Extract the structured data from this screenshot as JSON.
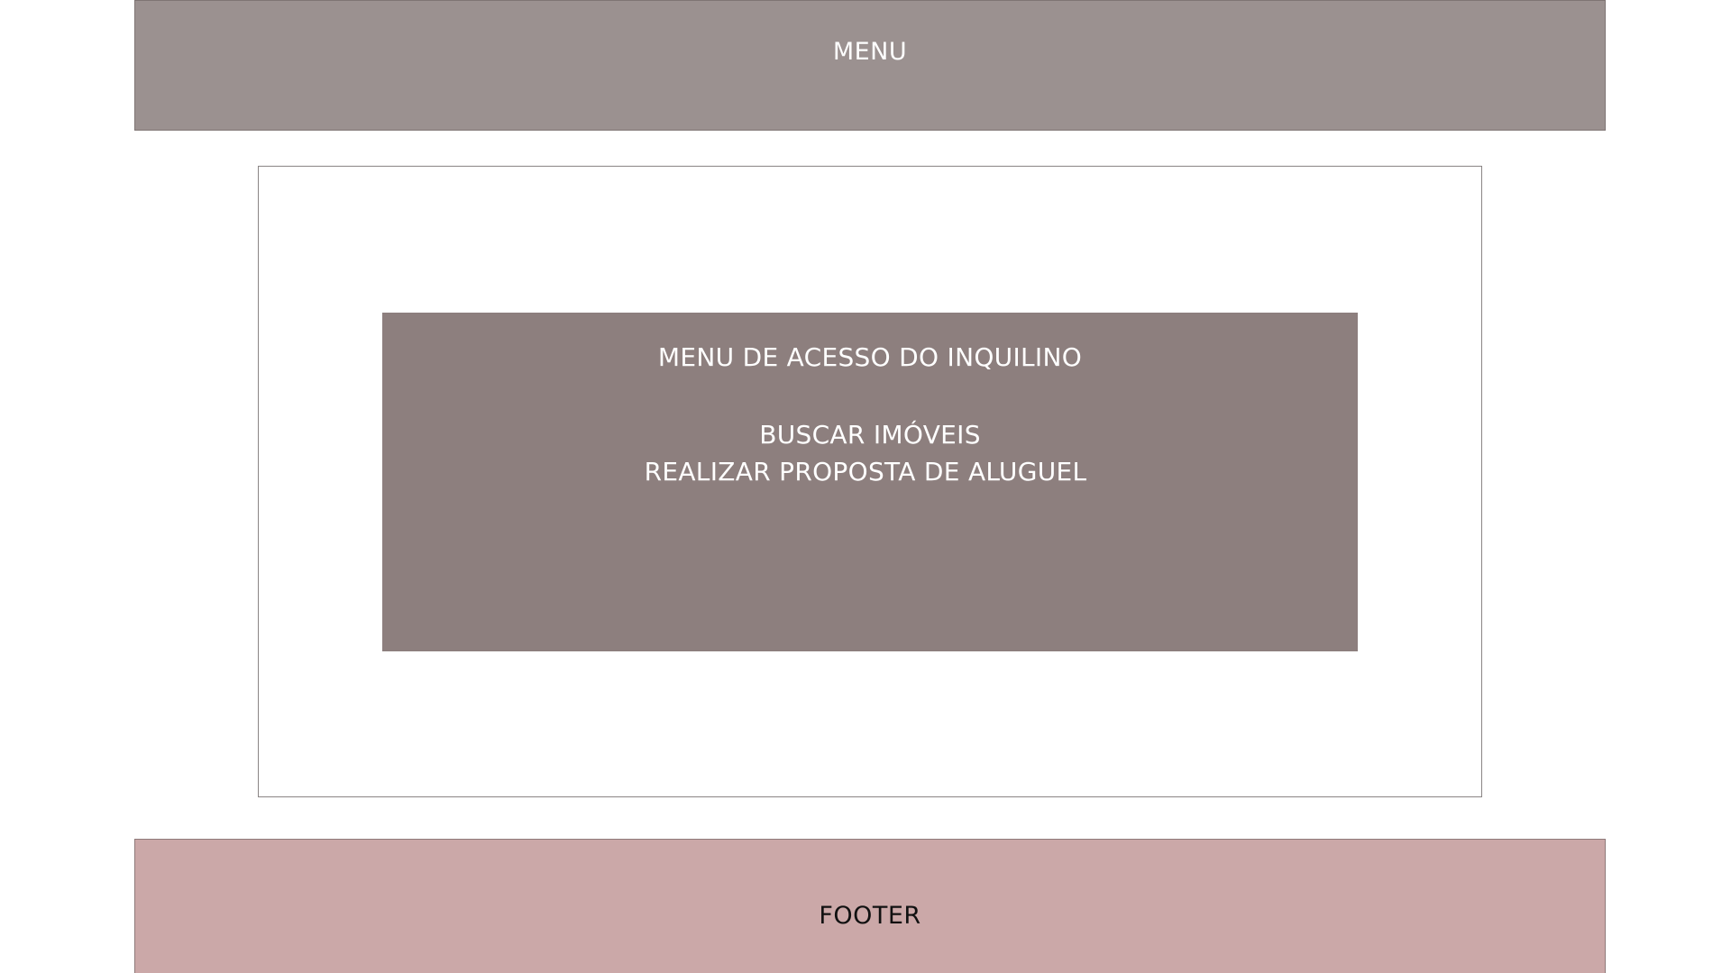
{
  "header": {
    "menu_label": "MENU"
  },
  "tenant_menu": {
    "title": "MENU DE ACESSO DO INQUILINO",
    "options": [
      {
        "label": "BUSCAR IMÓVEIS"
      },
      {
        "label": "REALIZAR PROPOSTA DE ALUGUEL"
      }
    ]
  },
  "footer": {
    "label": "FOOTER"
  },
  "colors": {
    "menu_background": "#9b9190",
    "panel_background": "#8d7f7e",
    "footer_background": "#cba8a8",
    "page_background": "#ffffff"
  }
}
